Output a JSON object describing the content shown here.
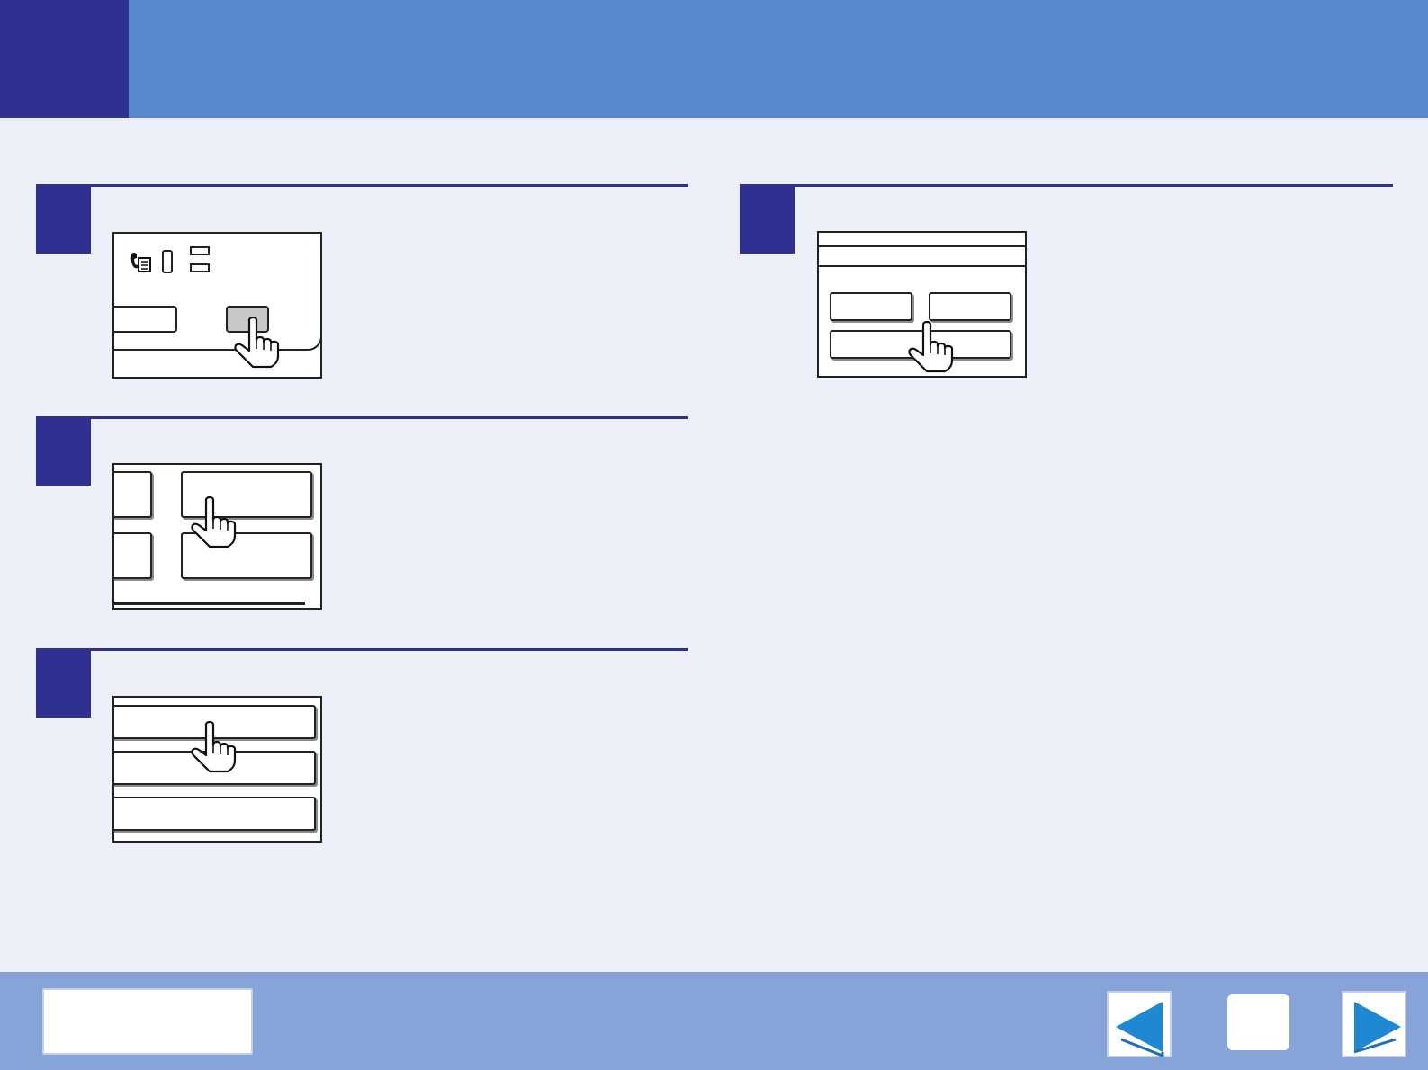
{
  "header": {
    "title": ""
  },
  "steps": [
    {
      "number": "",
      "text": ""
    },
    {
      "number": "",
      "text": ""
    },
    {
      "number": "",
      "text": ""
    },
    {
      "number": "",
      "text": ""
    }
  ],
  "footer": {
    "contents_label": "",
    "prev_icon": "left-arrow-icon",
    "home_icon": "home-icon",
    "next_icon": "right-arrow-icon"
  },
  "colors": {
    "header": "#5887cb",
    "accent": "#2e3192",
    "background": "#edf0f9",
    "footer": "#87a4d8",
    "arrow": "#1e88d2"
  }
}
